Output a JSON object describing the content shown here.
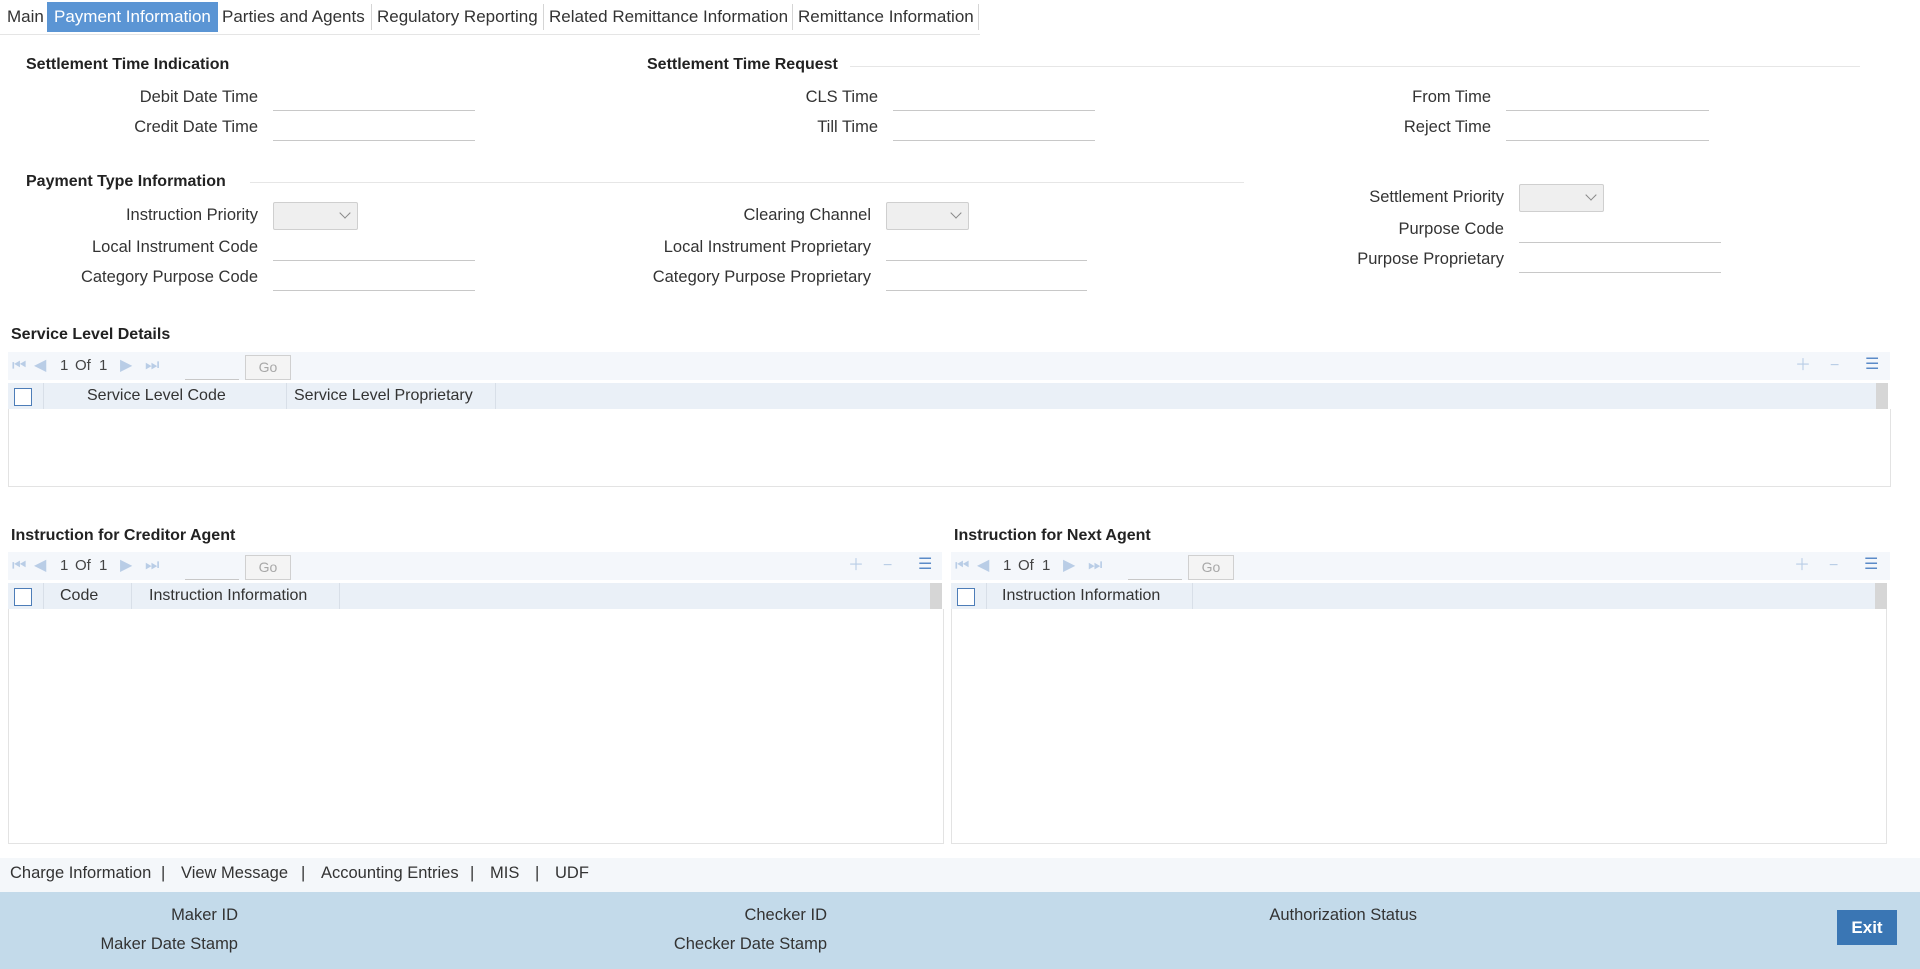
{
  "tabs": [
    "Main",
    "Payment Information",
    "Parties and Agents",
    "Regulatory Reporting",
    "Related Remittance Information",
    "Remittance Information"
  ],
  "settlement_time_indication": {
    "title": "Settlement Time Indication",
    "debit_date_time": "Debit Date Time",
    "credit_date_time": "Credit Date Time"
  },
  "settlement_time_request": {
    "title": "Settlement Time Request",
    "cls_time": "CLS Time",
    "till_time": "Till Time",
    "from_time": "From Time",
    "reject_time": "Reject Time"
  },
  "payment_type_information": {
    "title": "Payment Type Information",
    "instruction_priority": "Instruction Priority",
    "local_instrument_code": "Local Instrument Code",
    "category_purpose_code": "Category Purpose Code",
    "clearing_channel": "Clearing Channel",
    "local_instrument_proprietary": "Local Instrument Proprietary",
    "category_purpose_proprietary": "Category Purpose Proprietary",
    "settlement_priority": "Settlement Priority",
    "purpose_code": "Purpose Code",
    "purpose_proprietary": "Purpose Proprietary"
  },
  "service_level_details": {
    "title": "Service Level Details",
    "page": "1",
    "of": "Of",
    "total": "1",
    "go": "Go",
    "columns": [
      "Service Level Code",
      "Service Level Proprietary"
    ]
  },
  "creditor_agent": {
    "title": "Instruction for Creditor Agent",
    "page": "1",
    "of": "Of",
    "total": "1",
    "go": "Go",
    "columns": [
      "Code",
      "Instruction Information"
    ]
  },
  "next_agent": {
    "title": "Instruction for Next Agent",
    "page": "1",
    "of": "Of",
    "total": "1",
    "go": "Go",
    "columns": [
      "Instruction Information"
    ]
  },
  "footer_links": [
    "Charge Information",
    "View Message",
    "Accounting Entries",
    "MIS",
    "UDF"
  ],
  "footer_separator": "|",
  "status": {
    "maker_id": "Maker ID",
    "maker_date_stamp": "Maker Date Stamp",
    "checker_id": "Checker ID",
    "checker_date_stamp": "Checker Date Stamp",
    "authorization_status": "Authorization Status"
  },
  "exit_label": "Exit",
  "icons": {
    "first": "first-page-icon",
    "prev": "previous-page-icon",
    "next": "next-page-icon",
    "last": "last-page-icon",
    "add": "add-row-icon",
    "remove": "remove-row-icon",
    "columns": "column-settings-icon",
    "dropdown": "chevron-down-icon"
  },
  "colors": {
    "active_tab": "#5b95d4",
    "status_bar": "#c3daea",
    "exit_button": "#3a76b4",
    "grid_header": "#eaf0f7"
  }
}
